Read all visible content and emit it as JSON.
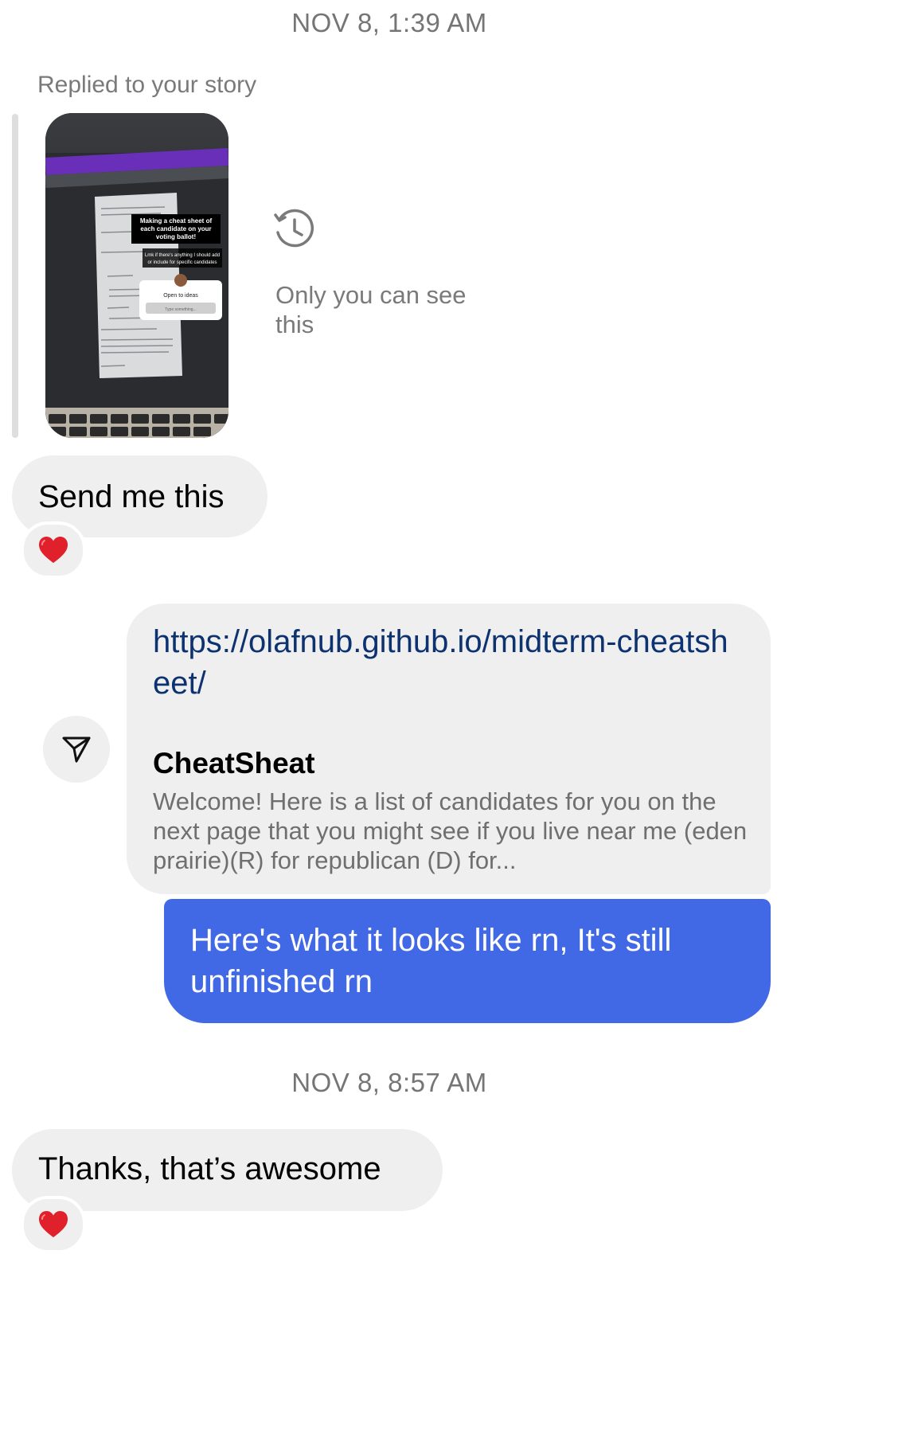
{
  "thread": {
    "timestamp_1": "NOV 8, 1:39 AM",
    "timestamp_2": "NOV 8, 8:57 AM"
  },
  "story_reply": {
    "label": "Replied to your story",
    "story_caption": "Making a cheat sheet of each candidate on your voting ballot!",
    "story_subcaption": "Lmk if there's anything I should add or include for specific candidates",
    "story_sticker_label": "Open to ideas",
    "story_sticker_input": "Type something...",
    "privacy_note": "Only you can see this",
    "history_icon": "history-icon"
  },
  "messages": [
    {
      "sender": "them",
      "text": "Send me this",
      "reaction": "❤️"
    },
    {
      "sender": "me",
      "type": "link",
      "url": "https://olafnub.github.io/midterm-cheatsheet/",
      "title": "CheatSheat",
      "description": "Welcome! Here is a list of candidates for you on the next page that you might see if you live near me (eden prairie)(R) for republican (D) for..."
    },
    {
      "sender": "me",
      "text": "Here's what it looks like rn, It's still unfinished rn"
    },
    {
      "sender": "them",
      "text": "Thanks, that’s awesome",
      "reaction": "❤️"
    }
  ],
  "colors": {
    "outgoing_bubble": "#4169e6",
    "incoming_bubble": "#efefef",
    "link_text": "#0d3270",
    "meta_text": "#757575"
  }
}
